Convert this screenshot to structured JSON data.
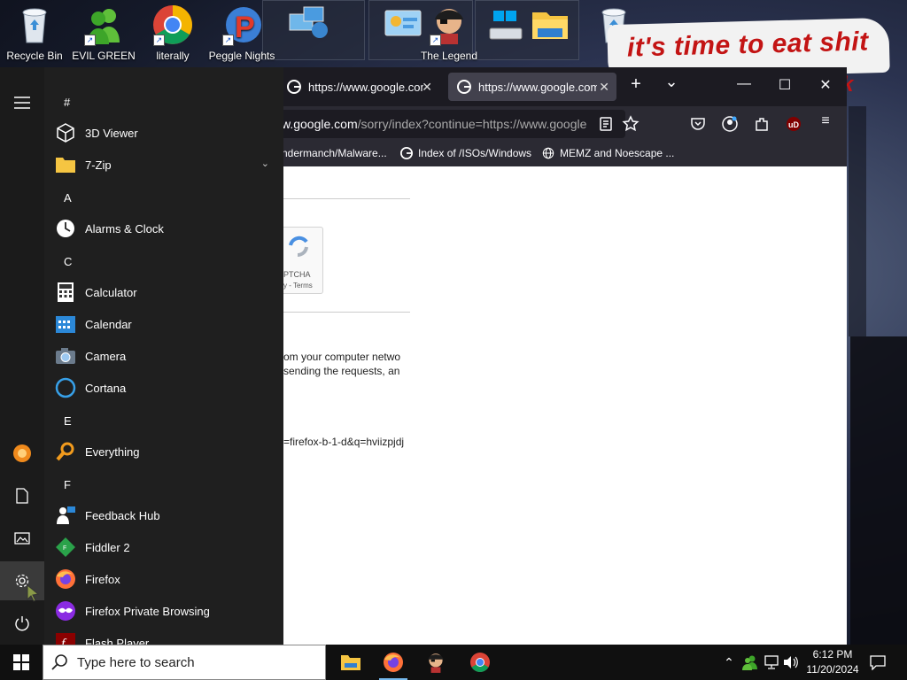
{
  "desktop": {
    "icons": [
      {
        "label": "Recycle Bin"
      },
      {
        "label": "EVIL GREEN"
      },
      {
        "label": "literally"
      },
      {
        "label": "Peggle Nights"
      },
      {
        "label": "The Legend"
      }
    ],
    "banner_text": "it's time to eat shit",
    "banner_extra": "k"
  },
  "browser": {
    "tabs": [
      {
        "title": "https://www.google.com",
        "active": false
      },
      {
        "title": "https://www.google.com",
        "active": true
      }
    ],
    "new_tab": "+",
    "tab_list": "⌄",
    "address": "w.google.com/sorry/index?continue=https://www.google",
    "address_domain": "w.google.com",
    "address_rest": "/sorry/index?continue=https://www.google",
    "bookmarks": [
      {
        "label": "ndermanch/Malware..."
      },
      {
        "label": "Index of /ISOs/Windows"
      },
      {
        "label": "MEMZ and Noescape ..."
      }
    ],
    "page": {
      "captcha_line1": "PTCHA",
      "captcha_line2": "y - Terms",
      "text_line1": "om your computer netwo",
      "text_line2": "sending the requests, an",
      "text_line3": "=firefox-b-1-d&q=hviizpjdj"
    },
    "colors": {
      "toolbar": "#2b2a33",
      "tab_active": "#42414d",
      "ublock": "#800000"
    }
  },
  "start_menu": {
    "sections": [
      {
        "letter": "#",
        "apps": [
          {
            "name": "3D Viewer",
            "icon": "cube-icon"
          },
          {
            "name": "7-Zip",
            "icon": "folder-icon",
            "expandable": true
          }
        ]
      },
      {
        "letter": "A",
        "apps": [
          {
            "name": "Alarms & Clock",
            "icon": "clock-icon"
          }
        ]
      },
      {
        "letter": "C",
        "apps": [
          {
            "name": "Calculator",
            "icon": "calculator-icon"
          },
          {
            "name": "Calendar",
            "icon": "calendar-icon"
          },
          {
            "name": "Camera",
            "icon": "camera-icon"
          },
          {
            "name": "Cortana",
            "icon": "cortana-icon"
          }
        ]
      },
      {
        "letter": "E",
        "apps": [
          {
            "name": "Everything",
            "icon": "search-icon"
          }
        ]
      },
      {
        "letter": "F",
        "apps": [
          {
            "name": "Feedback Hub",
            "icon": "feedback-icon"
          },
          {
            "name": "Fiddler 2",
            "icon": "fiddler-icon"
          },
          {
            "name": "Firefox",
            "icon": "firefox-icon"
          },
          {
            "name": "Firefox Private Browsing",
            "icon": "private-browsing-icon"
          },
          {
            "name": "Flash Player",
            "icon": "flash-icon"
          }
        ]
      }
    ]
  },
  "taskbar": {
    "search_placeholder": "Type here to search",
    "time": "6:12 PM",
    "date": "11/20/2024"
  }
}
